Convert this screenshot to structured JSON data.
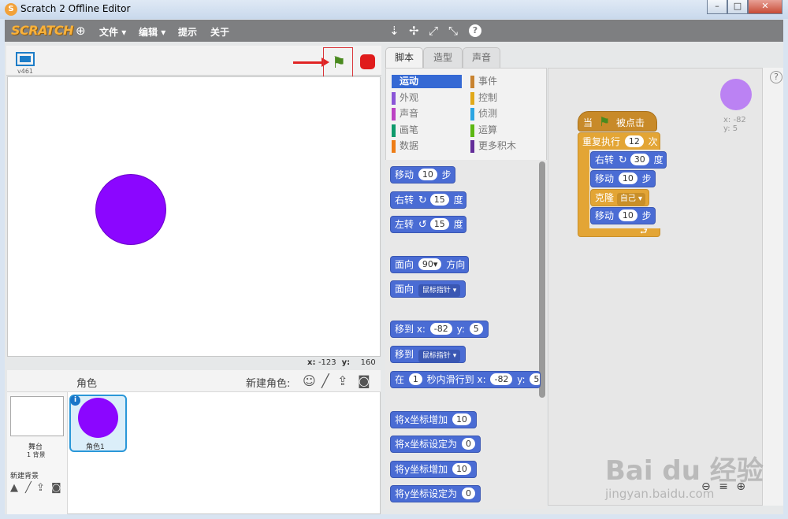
{
  "window": {
    "title": "Scratch 2 Offline Editor",
    "min": "–",
    "max": "□",
    "close": "✕"
  },
  "menubar": {
    "logo": "SCRATCH",
    "items": [
      "文件",
      "编辑",
      "提示",
      "关于"
    ],
    "tools": {
      "duplicate": "⇣",
      "delete": "✢",
      "grow": "⤢",
      "shrink": "⤡",
      "help": "?"
    }
  },
  "stage": {
    "version": "v461",
    "mouse_x_label": "x:",
    "mouse_x": "-123",
    "mouse_y_label": "y:",
    "mouse_y": "160"
  },
  "sprites_panel": {
    "title": "角色",
    "new_sprite_label": "新建角色:",
    "stage_name": "舞台",
    "stage_backdrops": "1 背景",
    "new_backdrop_label": "新建背景",
    "sprite_name": "角色1",
    "info": "i"
  },
  "tabs": [
    "脚本",
    "造型",
    "声音"
  ],
  "categories": {
    "left": [
      "运动",
      "外观",
      "声音",
      "画笔",
      "数据"
    ],
    "right": [
      "事件",
      "控制",
      "侦测",
      "运算",
      "更多积木"
    ],
    "colors": {
      "运动": "#4a6cd4",
      "外观": "#8a55d7",
      "声音": "#bb42c3",
      "画笔": "#0e9a6c",
      "数据": "#ee7d16",
      "事件": "#c88330",
      "控制": "#e1a91a",
      "侦测": "#2ca5e2",
      "运算": "#5cb712",
      "更多积木": "#632d99"
    }
  },
  "palette_blocks": {
    "move": {
      "a": "移动",
      "n": "10",
      "b": "步"
    },
    "turn_right": {
      "a": "右转",
      "n": "15",
      "b": "度"
    },
    "turn_left": {
      "a": "左转",
      "n": "15",
      "b": "度"
    },
    "point_dir": {
      "a": "面向",
      "n": "90▾",
      "b": "方向"
    },
    "point_towards": {
      "a": "面向",
      "d": "鼠标指针 ▾"
    },
    "goto_xy": {
      "a": "移到 x:",
      "x": "-82",
      "b": "y:",
      "y": "5"
    },
    "goto": {
      "a": "移到",
      "d": "鼠标指针 ▾"
    },
    "glide": {
      "a": "在",
      "t": "1",
      "b": "秒内滑行到 x:",
      "x": "-82",
      "c": "y:",
      "y": "5"
    },
    "change_x": {
      "a": "将x坐标增加",
      "n": "10"
    },
    "set_x": {
      "a": "将x坐标设定为",
      "n": "0"
    },
    "change_y": {
      "a": "将y坐标增加",
      "n": "10"
    },
    "set_y": {
      "a": "将y坐标设定为",
      "n": "0"
    }
  },
  "script": {
    "hat": {
      "a": "当",
      "b": "被点击"
    },
    "repeat": {
      "a": "重复执行",
      "n": "12",
      "b": "次"
    },
    "turn": {
      "a": "右转",
      "n": "30",
      "b": "度"
    },
    "move1": {
      "a": "移动",
      "n": "10",
      "b": "步"
    },
    "clone": {
      "a": "克隆",
      "d": "自己 ▾"
    },
    "move2": {
      "a": "移动",
      "n": "10",
      "b": "步"
    },
    "sprite_x": "x: -82",
    "sprite_y": "y: 5"
  },
  "watermark": {
    "brand": "Bai du 经验",
    "url": "jingyan.baidu.com"
  }
}
